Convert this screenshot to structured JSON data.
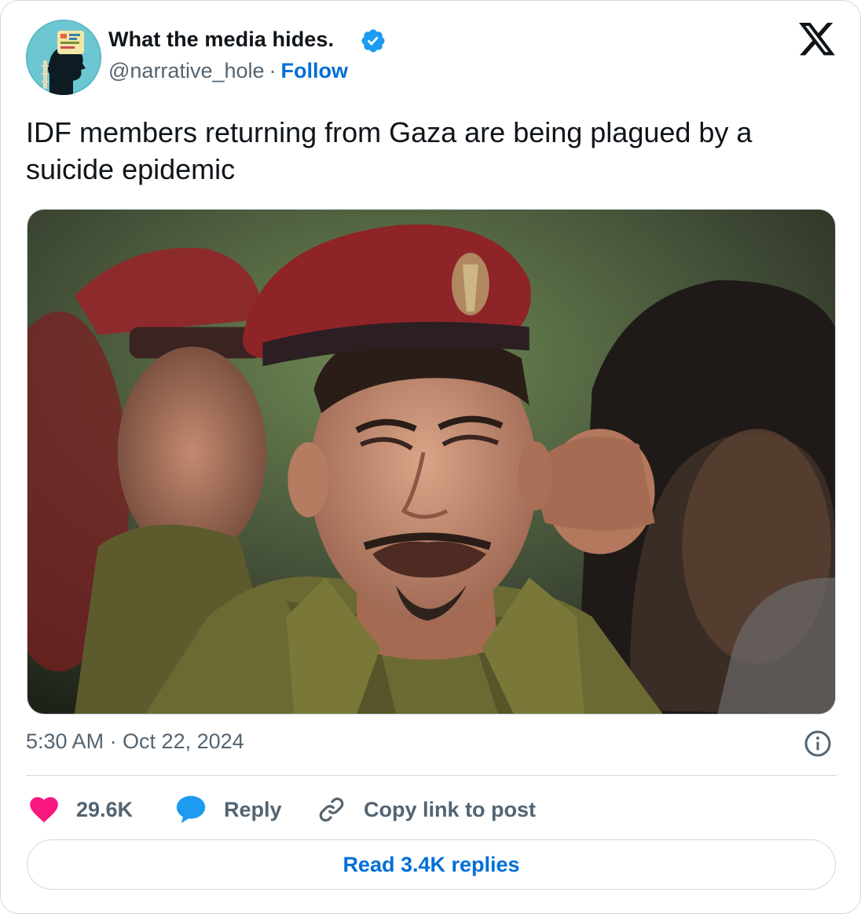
{
  "author": {
    "display_name": "What the media hides.",
    "handle": "@narrative_hole",
    "separator": "·",
    "follow_label": "Follow",
    "verified": true
  },
  "tweet": {
    "text": "IDF members returning from Gaza are being plagued by a suicide epidemic",
    "timestamp": "5:30 AM · Oct 22, 2024"
  },
  "actions": {
    "likes": "29.6K",
    "reply_label": "Reply",
    "copy_label": "Copy link to post"
  },
  "footer": {
    "read_replies_label": "Read 3.4K replies"
  },
  "icons": {
    "brand": "x-logo-icon",
    "verified": "verified-badge-icon",
    "info": "info-icon",
    "like": "heart-icon",
    "reply": "speech-bubble-icon",
    "copy": "link-icon"
  },
  "colors": {
    "link": "#006fd6",
    "verified": "#1d9bf0",
    "like": "#f91880",
    "reply": "#1d9bf0",
    "muted": "#536471",
    "border": "#cfd9de"
  }
}
